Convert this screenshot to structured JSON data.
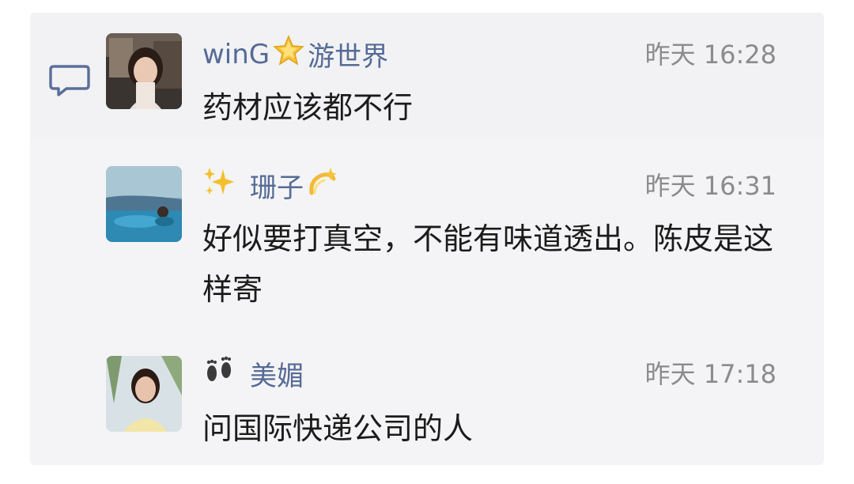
{
  "icons": {
    "comment": "comment-bubble-icon"
  },
  "comments": [
    {
      "avatar": "avatar-woman-cafe",
      "name_prefix": "winG",
      "name_emoji": "glowing-star-icon",
      "name_suffix": "游世界",
      "time": "昨天 16:28",
      "text": "药材应该都不行"
    },
    {
      "avatar": "avatar-pool",
      "name_prefix": "",
      "name_emoji_left": "sparkles-icon",
      "name_suffix": "珊子",
      "name_emoji_right": "dizzy-icon",
      "time": "昨天 16:31",
      "text": "好似要打真空，不能有味道透出。陈皮是这样寄"
    },
    {
      "avatar": "avatar-woman-lake",
      "name_emoji_left": "footprints-icon",
      "name_suffix": "美媚",
      "time": "昨天 17:18",
      "text": "问国际快递公司的人"
    }
  ],
  "colors": {
    "name": "#556b96",
    "time": "#8b8b8f",
    "text": "#1b1b1b",
    "panel": "#f4f4f6"
  }
}
